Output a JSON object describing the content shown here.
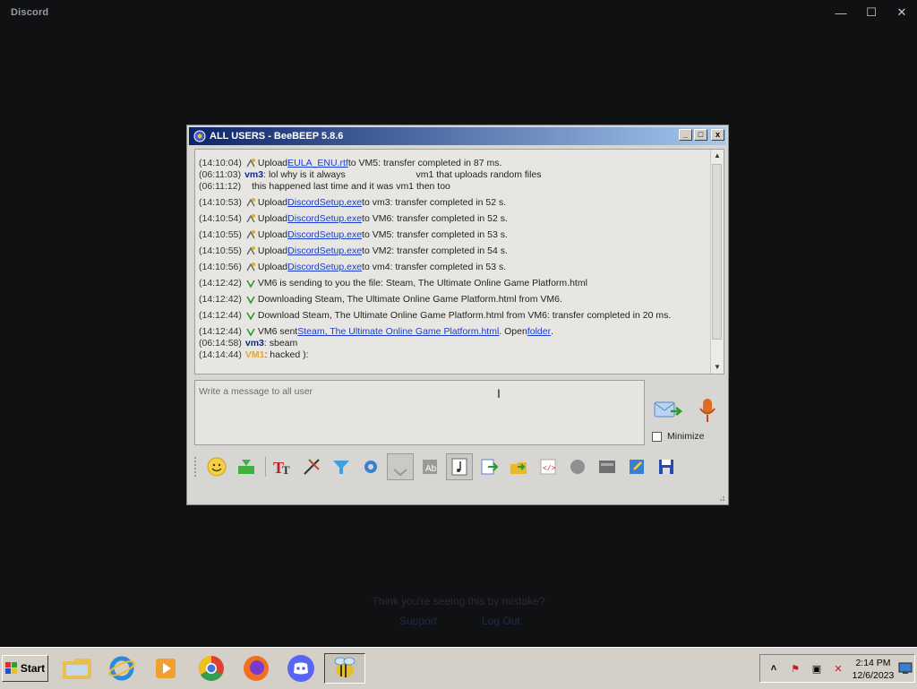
{
  "discord": {
    "title": "Discord",
    "background_text": "Think you're seeing this by mistake?",
    "link_support": "Support",
    "link_logout": "Log Out"
  },
  "beebeep": {
    "title": "ALL USERS - BeeBEEP 5.8.6",
    "messages": [
      {
        "ts": "(14:10:04)",
        "pre": "Upload ",
        "link": "EULA_ENU.rtf",
        "post": " to VM5: transfer completed in 87 ms."
      },
      {
        "ts": "(06:11:03)",
        "user": "vm3",
        "text": ": lol why is it always                           vm1 that uploads random files"
      },
      {
        "ts": "(06:11:12)",
        "text": "this happened last time and it was vm1 then too"
      },
      {
        "ts": "(14:10:53)",
        "pre": "Upload ",
        "link": "DiscordSetup.exe",
        "post": " to vm3: transfer completed in 52 s."
      },
      {
        "ts": "(14:10:54)",
        "pre": "Upload ",
        "link": "DiscordSetup.exe",
        "post": " to VM6: transfer completed in 52 s."
      },
      {
        "ts": "(14:10:55)",
        "pre": "Upload ",
        "link": "DiscordSetup.exe",
        "post": " to VM5: transfer completed in 53 s."
      },
      {
        "ts": "(14:10:55)",
        "pre": "Upload ",
        "link": "DiscordSetup.exe",
        "post": " to VM2: transfer completed in 54 s."
      },
      {
        "ts": "(14:10:56)",
        "pre": "Upload ",
        "link": "DiscordSetup.exe",
        "post": " to vm4: transfer completed in 53 s."
      },
      {
        "ts": "(14:12:42)",
        "text": "VM6 is sending to you the file: Steam, The Ultimate Online Game Platform.html"
      },
      {
        "ts": "(14:12:42)",
        "text": "Downloading Steam, The Ultimate Online Game Platform.html from VM6."
      },
      {
        "ts": "(14:12:44)",
        "text": "Download Steam, The Ultimate Online Game Platform.html from VM6: transfer completed in 20 ms."
      },
      {
        "ts": "(14:12:44)",
        "pre": "VM6 sent ",
        "link": "Steam, The Ultimate Online Game Platform.html",
        "post": ". Open ",
        "link2": "folder",
        "post2": "."
      },
      {
        "ts": "(06:14:58)",
        "user": "vm3",
        "text": ": sbeam"
      },
      {
        "ts": "(14:14:44)",
        "user": "VM1",
        "text": ": hacked ):"
      }
    ],
    "input_placeholder": "Write a message to all user",
    "minimize_label": "Minimize"
  },
  "taskbar": {
    "start_label": "Start",
    "time": "2:14 PM",
    "date": "12/6/2023"
  }
}
